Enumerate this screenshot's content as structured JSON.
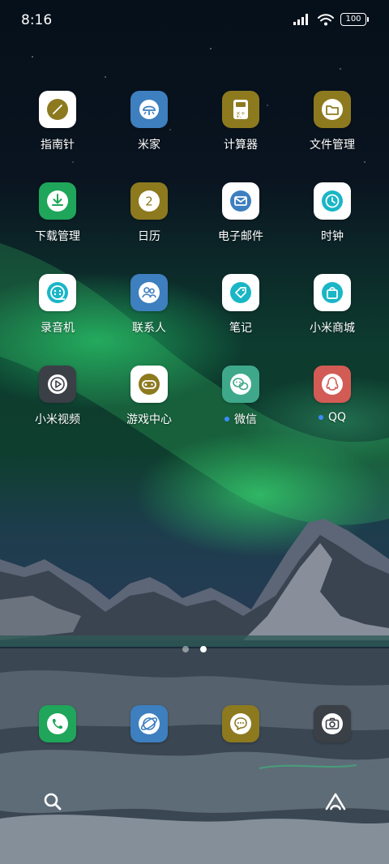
{
  "status_bar": {
    "time": "8:16",
    "battery": "100",
    "icons": [
      "signal-icon",
      "wifi-icon",
      "battery-icon"
    ]
  },
  "apps": [
    [
      {
        "label": "指南针",
        "icon": "compass-icon",
        "tile_color": "#ffffff",
        "glyph_color": "#8d7a1f"
      },
      {
        "label": "米家",
        "icon": "smart-home-icon",
        "tile_color": "#3d7fbf",
        "glyph_color": "#ffffff"
      },
      {
        "label": "计算器",
        "icon": "calculator-icon",
        "tile_color": "#8d7a1f",
        "glyph_color": "#ffffff"
      },
      {
        "label": "文件管理",
        "icon": "folder-icon",
        "tile_color": "#8d7a1f",
        "glyph_color": "#ffffff"
      }
    ],
    [
      {
        "label": "下载管理",
        "icon": "download-icon",
        "tile_color": "#1fa65a",
        "glyph_color": "#ffffff"
      },
      {
        "label": "日历",
        "icon": "calendar-icon",
        "tile_color": "#8d7a1f",
        "glyph_color": "#ffffff",
        "glyph_text": "2"
      },
      {
        "label": "电子邮件",
        "icon": "email-icon",
        "tile_color": "#ffffff",
        "glyph_color": "#3d7fbf"
      },
      {
        "label": "时钟",
        "icon": "clock-icon",
        "tile_color": "#ffffff",
        "glyph_color": "#19b6c6"
      }
    ],
    [
      {
        "label": "录音机",
        "icon": "recorder-icon",
        "tile_color": "#ffffff",
        "glyph_color": "#19b6c6"
      },
      {
        "label": "联系人",
        "icon": "contacts-icon",
        "tile_color": "#3d7fbf",
        "glyph_color": "#ffffff"
      },
      {
        "label": "笔记",
        "icon": "notes-icon",
        "tile_color": "#ffffff",
        "glyph_color": "#19b6c6"
      },
      {
        "label": "小米商城",
        "icon": "shopping-bag-icon",
        "tile_color": "#ffffff",
        "glyph_color": "#19b6c6"
      }
    ],
    [
      {
        "label": "小米视频",
        "icon": "video-play-icon",
        "tile_color": "#3b3f46",
        "glyph_color": "#ffffff"
      },
      {
        "label": "游戏中心",
        "icon": "gamepad-icon",
        "tile_color": "#ffffff",
        "glyph_color": "#8d7a1f"
      },
      {
        "label": "微信",
        "icon": "wechat-icon",
        "tile_color": "#3fa88a",
        "glyph_color": "#ffffff",
        "new_dot": true
      },
      {
        "label": "QQ",
        "icon": "qq-penguin-icon",
        "tile_color": "#d35b55",
        "glyph_color": "#ffffff",
        "new_dot": true
      }
    ]
  ],
  "page_indicator": {
    "count": 2,
    "active": 2
  },
  "dock": [
    {
      "icon": "phone-icon",
      "tile_color": "#1fa65a"
    },
    {
      "icon": "browser-icon",
      "tile_color": "#3d7fbf"
    },
    {
      "icon": "messages-icon",
      "tile_color": "#8d7a1f"
    },
    {
      "icon": "camera-icon",
      "tile_color": "#3b3f46"
    }
  ],
  "bottom_actions": [
    {
      "icon": "search-icon"
    },
    {
      "icon": "assistant-icon"
    }
  ]
}
